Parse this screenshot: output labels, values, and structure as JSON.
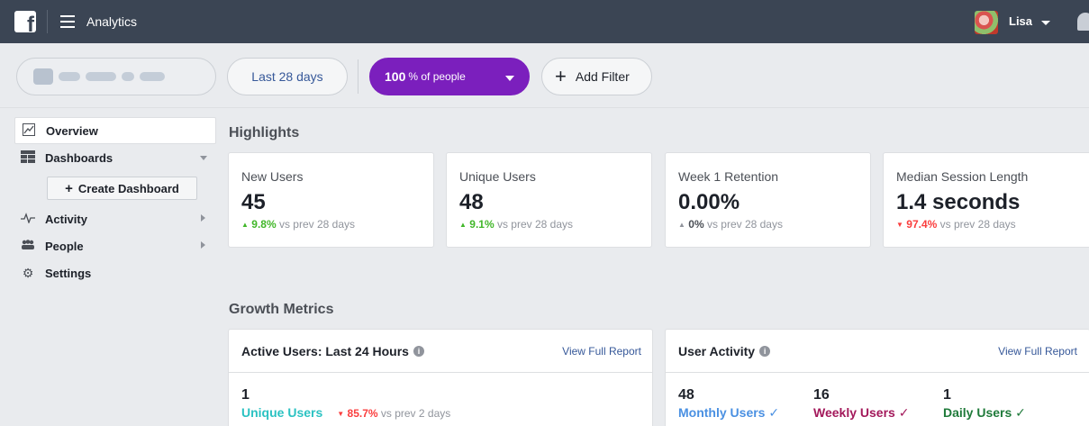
{
  "topbar": {
    "logo_letter": "f",
    "app_title": "Analytics",
    "user_name": "Lisa"
  },
  "filters": {
    "date_range": "Last 28 days",
    "people_pct": "100",
    "people_rest": "% of people",
    "add_filter": "Add Filter"
  },
  "sidebar": {
    "items": [
      {
        "label": "Overview",
        "icon": "chart-icon"
      },
      {
        "label": "Dashboards",
        "icon": "grid-icon"
      },
      {
        "label": "Activity",
        "icon": "pulse-icon"
      },
      {
        "label": "People",
        "icon": "people-icon"
      },
      {
        "label": "Settings",
        "icon": "gear-icon"
      }
    ],
    "create_dashboard": "Create Dashboard"
  },
  "highlights": {
    "title": "Highlights",
    "cards": [
      {
        "label": "New Users",
        "value": "45",
        "delta": "9.8%",
        "suffix": " vs prev 28 days",
        "direction": "up"
      },
      {
        "label": "Unique Users",
        "value": "48",
        "delta": "9.1%",
        "suffix": " vs prev 28 days",
        "direction": "up"
      },
      {
        "label": "Week 1 Retention",
        "value": "0.00%",
        "delta": "0%",
        "suffix": " vs prev 28 days",
        "direction": "flat"
      },
      {
        "label": "Median Session Length",
        "value": "1.4 seconds",
        "delta": "97.4%",
        "suffix": " vs prev 28 days",
        "direction": "down"
      }
    ]
  },
  "growth": {
    "title": "Growth Metrics",
    "active_users": {
      "title": "Active Users: Last 24 Hours",
      "link": "View Full Report",
      "value": "1",
      "label": "Unique Users",
      "delta": "85.7%",
      "suffix": " vs prev 2 days"
    },
    "user_activity": {
      "title": "User Activity",
      "link": "View Full Report",
      "stats": [
        {
          "value": "48",
          "label": "Monthly Users",
          "color": "#4a90e2"
        },
        {
          "value": "16",
          "label": "Weekly Users",
          "color": "#a3195b"
        },
        {
          "value": "1",
          "label": "Daily Users",
          "color": "#1f7a3a"
        }
      ]
    }
  },
  "colors": {
    "topbar": "#3b4554",
    "people_filter": "#7b1fbd",
    "up": "#42b72a",
    "down": "#fa3e3e",
    "link": "#365899",
    "unique_users": "#2bc2c2"
  }
}
